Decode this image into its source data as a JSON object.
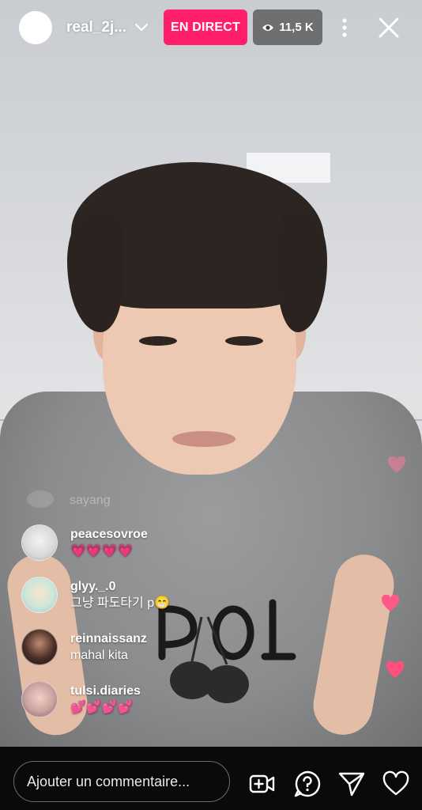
{
  "header": {
    "username": "real_2j...",
    "live_label": "EN DIRECT",
    "viewer_count": "11,5 K"
  },
  "comments": {
    "ghost": "sayang",
    "items": [
      {
        "user": "peacesovroe",
        "message": "💗💗💗💗"
      },
      {
        "user": "glyy._.0",
        "message": "그냥 파도타기 p😁"
      },
      {
        "user": "reinnaissanz",
        "message": "mahal kita"
      },
      {
        "user": "tulsi.diaries",
        "message": "💕💕💕💕"
      }
    ]
  },
  "footer": {
    "comment_placeholder": "Ajouter un commentaire..."
  },
  "colors": {
    "live_badge": "#ff1f6b",
    "heart": "#ff5a87"
  },
  "icons": [
    "avatar",
    "chevron-down-icon",
    "eye-icon",
    "more-vertical-icon",
    "close-icon",
    "add-video-icon",
    "question-icon",
    "send-icon",
    "heart-icon"
  ]
}
